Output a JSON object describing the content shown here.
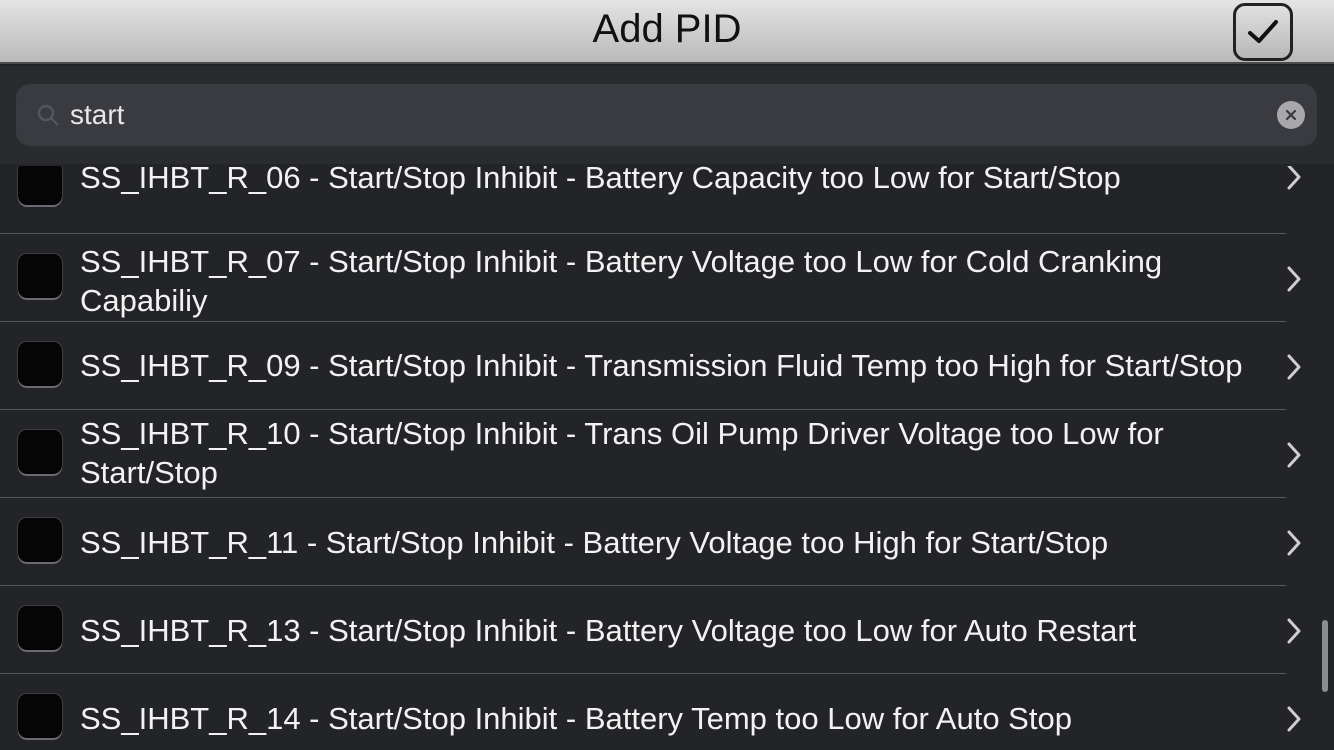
{
  "navbar": {
    "title": "Add PID",
    "done_icon": "checkmark-icon"
  },
  "search": {
    "value": "start",
    "icon": "search-icon",
    "clear_icon": "clear-icon"
  },
  "rows": [
    {
      "label": "SS_IHBT_R_06 - Start/Stop Inhibit - Battery Capacity too Low for Start/Stop",
      "checked": false
    },
    {
      "label": "SS_IHBT_R_07 - Start/Stop Inhibit - Battery Voltage too Low for Cold Cranking Capabiliy",
      "checked": false
    },
    {
      "label": "SS_IHBT_R_09 - Start/Stop Inhibit - Transmission Fluid Temp too High for Start/Stop",
      "checked": false
    },
    {
      "label": "SS_IHBT_R_10 - Start/Stop Inhibit - Trans Oil Pump Driver Voltage too Low for Start/Stop",
      "checked": false
    },
    {
      "label": "SS_IHBT_R_11 - Start/Stop Inhibit - Battery Voltage too High for Start/Stop",
      "checked": false
    },
    {
      "label": "SS_IHBT_R_13 - Start/Stop Inhibit - Battery Voltage too Low for Auto Restart",
      "checked": false
    },
    {
      "label": "SS_IHBT_R_14 - Start/Stop Inhibit - Battery Temp too Low for Auto Stop",
      "checked": false
    }
  ],
  "colors": {
    "background": "#232427",
    "navbar": "#cfcfcf",
    "text": "#f2f2f2"
  }
}
